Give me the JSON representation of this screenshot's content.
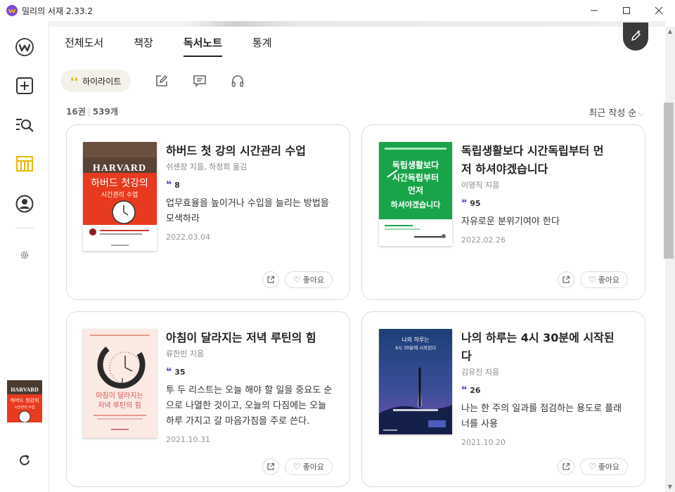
{
  "window": {
    "title": "밀리의 서재 2.33.2",
    "controls": [
      "minimize",
      "maximize",
      "close"
    ]
  },
  "sidebar": {
    "items": [
      {
        "name": "home",
        "icon": "millie-logo-icon"
      },
      {
        "name": "add",
        "icon": "plus-square-icon"
      },
      {
        "name": "search",
        "icon": "search-list-icon"
      },
      {
        "name": "library",
        "icon": "bookshelf-icon",
        "active": true
      },
      {
        "name": "profile",
        "icon": "user-circle-icon"
      },
      {
        "name": "settings",
        "icon": "gear-icon"
      },
      {
        "name": "refresh",
        "icon": "refresh-icon"
      }
    ],
    "current_book_cover_text": "HARVARD 하버드 첫 강의 시간관리 수업"
  },
  "tabs": [
    {
      "label": "전체도서"
    },
    {
      "label": "책장"
    },
    {
      "label": "독서노트",
      "active": true
    },
    {
      "label": "통계"
    }
  ],
  "filters": {
    "highlight_label": "하이라이트",
    "icons": [
      "pen-note-icon",
      "comment-icon",
      "headphones-icon"
    ]
  },
  "summary": {
    "books": "16권",
    "notes": "539개"
  },
  "sort": {
    "label": "최근 작성 순"
  },
  "cards": [
    {
      "title_lines": [
        "하버드 첫 강의 시간관리 수업"
      ],
      "author": "쉬셴장 지음, 하정희 옮김",
      "highlights": "8",
      "memo_lines": [
        "업무효율을 높이거나 수입을 늘리는 방법을",
        "모색하라"
      ],
      "date": "2022.03.04",
      "like_label": "좋아요",
      "cover": {
        "top_text": "HARVARD",
        "main_text": "하버드 첫강의",
        "sub_text": "시간관리 수업"
      }
    },
    {
      "title_lines": [
        "독립생활보다 시간독립부터 먼",
        "저 하셔야겠습니다"
      ],
      "author": "이영직 지음",
      "highlights": "95",
      "memo_lines": [
        "자유로운 분위기여야 한다"
      ],
      "date": "2022.02.26",
      "like_label": "좋아요",
      "cover": {
        "main_lines": [
          "독립생활보다",
          "시간독립부터",
          "먼저",
          "하셔야겠습니다"
        ]
      }
    },
    {
      "title_lines": [
        "아침이 달라지는 저녁 루틴의 힘"
      ],
      "author": "류한빈 지음",
      "highlights": "35",
      "memo_lines": [
        "투 두 리스트는 오늘 해야 할 일을 중요도 순",
        "으로 나열한 것이고, 오늘의 다짐에는 오늘",
        "하루 가지고 갈 마음가짐을 주로 쓴다."
      ],
      "date": "2021.10.31",
      "like_label": "좋아요",
      "cover": {
        "main_lines": [
          "아침이 달라지는",
          "저녁 루틴의 힘"
        ]
      }
    },
    {
      "title_lines": [
        "나의 하루는 4시 30분에 시작된",
        "다"
      ],
      "author": "김유진 지음",
      "highlights": "26",
      "memo_lines": [
        "나는 한 주의 일과를 점검하는 용도로 플래",
        "너를 사용"
      ],
      "date": "2021.10.20",
      "like_label": "좋아요",
      "cover": {
        "main_lines": [
          "나의 하루는",
          "4시 30분에 시작된다"
        ]
      }
    }
  ],
  "colors": {
    "accent_purple": "#6b3fbf",
    "highlight_yellow": "#e9b800",
    "active_sidebar": "#e9b800"
  }
}
